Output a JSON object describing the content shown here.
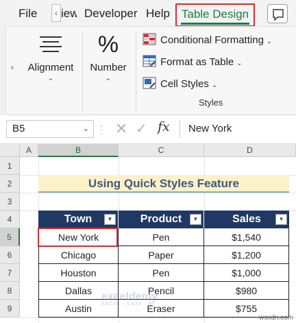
{
  "tabs": {
    "file": "File",
    "view": "View",
    "developer": "Developer",
    "help": "Help",
    "table_design": "Table Design"
  },
  "ribbon": {
    "alignment_label": "Alignment",
    "number_label": "Number",
    "number_symbol": "%",
    "conditional_formatting": "Conditional Formatting",
    "format_as_table": "Format as Table",
    "cell_styles": "Cell Styles",
    "styles_group_label": "Styles"
  },
  "formula_bar": {
    "name_box": "B5",
    "fx": "fx",
    "value": "New York"
  },
  "grid": {
    "columns": [
      "A",
      "B",
      "C",
      "D"
    ],
    "rows": [
      "1",
      "2",
      "3",
      "4",
      "5",
      "6",
      "7",
      "8",
      "9"
    ]
  },
  "sheet": {
    "title": "Using Quick Styles Feature",
    "headers": [
      "Town",
      "Product",
      "Sales"
    ],
    "rows": [
      [
        "New York",
        "Pen",
        "$1,540"
      ],
      [
        "Chicago",
        "Paper",
        "$1,200"
      ],
      [
        "Houston",
        "Pen",
        "$1,000"
      ],
      [
        "Dallas",
        "Pencil",
        "$980"
      ],
      [
        "Austin",
        "Eraser",
        "$755"
      ]
    ]
  },
  "watermark": {
    "name": "exceldemy",
    "tagline": "EXCEL · DATA · BI"
  },
  "source": "wsxdn.com",
  "colors": {
    "accent_green": "#1d7a46",
    "highlight_red": "#e0282c",
    "table_header": "#203864",
    "title_fill": "#fdf1c8",
    "title_text": "#3e5a83"
  }
}
